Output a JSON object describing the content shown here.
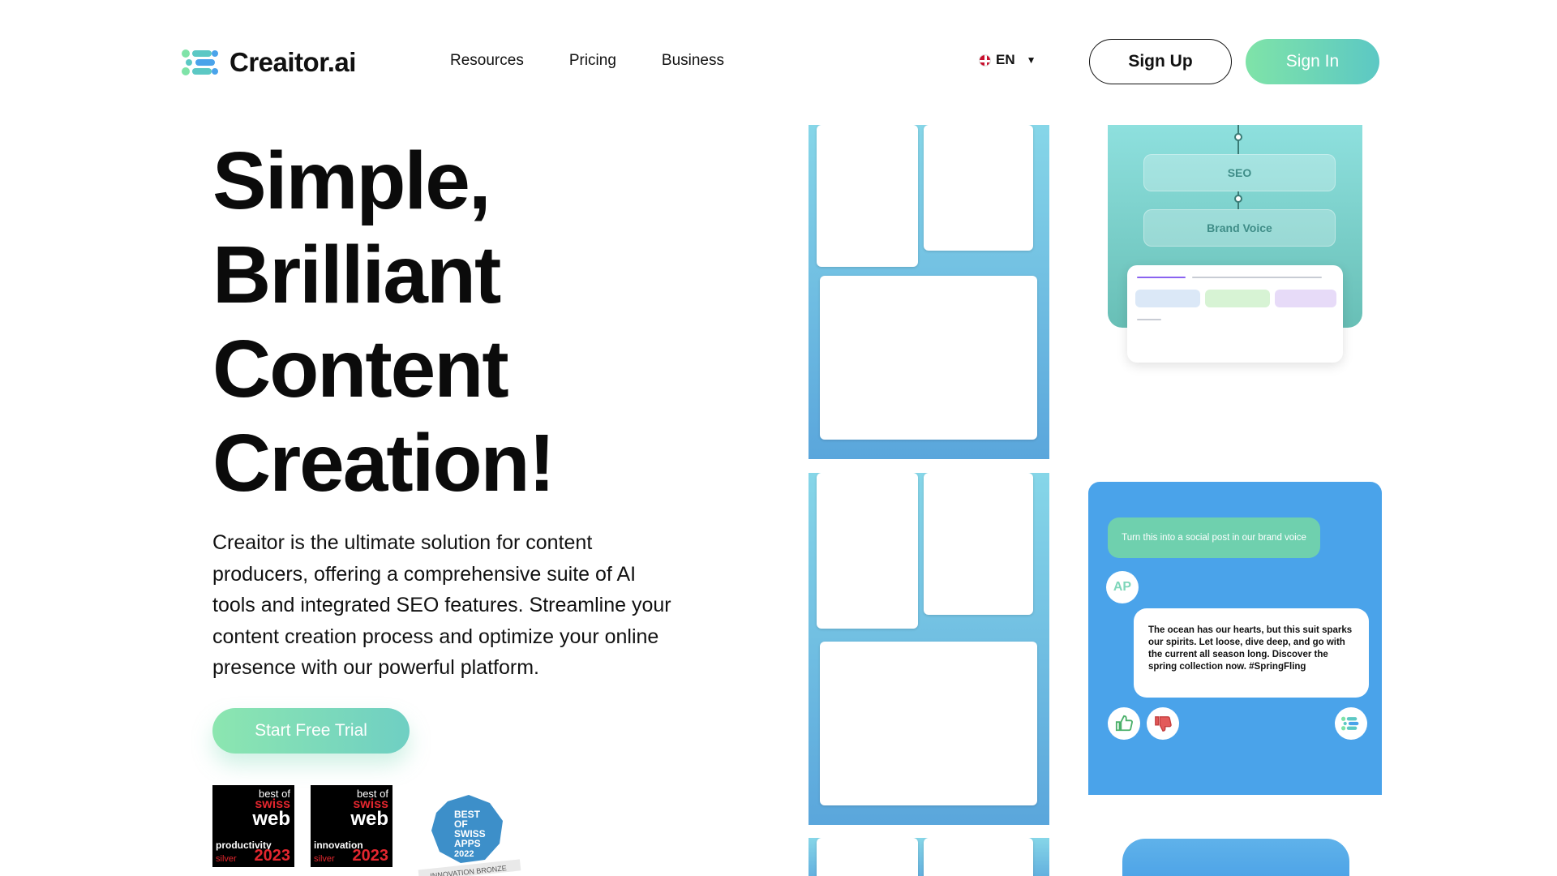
{
  "brand": {
    "name": "Creaitor.ai"
  },
  "nav": {
    "items": [
      "Resources",
      "Pricing",
      "Business"
    ]
  },
  "language": {
    "selected": "EN"
  },
  "header": {
    "signup_label": "Sign Up",
    "signin_label": "Sign In"
  },
  "hero": {
    "title_lines": [
      "Simple,",
      "Brilliant",
      "Content",
      "Creation!"
    ],
    "subtitle": "Creaitor is the ultimate solution for content producers, offering a comprehensive suite of AI tools and integrated SEO features. Streamline your content creation process and optimize your online presence with our powerful platform.",
    "cta_label": "Start Free Trial"
  },
  "awards": [
    {
      "line1": "best of",
      "line2": "swiss",
      "line3": "web",
      "category": "productivity",
      "level": "silver",
      "year": "2023"
    },
    {
      "line1": "best of",
      "line2": "swiss",
      "line3": "web",
      "category": "innovation",
      "level": "silver",
      "year": "2023"
    }
  ],
  "apps_badge": {
    "lines": [
      "BEST",
      "OF",
      "SWISS",
      "APPS",
      "2022"
    ],
    "ribbon": "INNOVATION BRONZE"
  },
  "flow_card": {
    "pills": [
      "SEO",
      "Brand Voice"
    ]
  },
  "chat_card": {
    "prompt": "Turn this into a social post in our brand voice",
    "avatar": "AP",
    "response": "The ocean has our hearts, but this suit sparks our spirits. Let loose, dive deep, and go with the current all season long. Discover the spring collection now. #SpringFling"
  },
  "colors": {
    "accent_green": "#7fe3a8",
    "accent_teal": "#5cc8c4",
    "chat_blue": "#4aa3ea"
  }
}
